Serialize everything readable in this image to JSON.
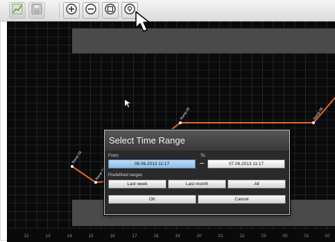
{
  "toolbar": {
    "buttons": [
      {
        "icon": "chart-icon",
        "style": "flat"
      },
      {
        "icon": "save-icon",
        "style": "flat"
      },
      {
        "icon": "zoom-in-icon",
        "style": "round"
      },
      {
        "icon": "zoom-out-icon",
        "style": "round"
      },
      {
        "icon": "zoom-fit-icon",
        "style": "round"
      },
      {
        "icon": "zoom-reset-icon",
        "style": "round"
      }
    ]
  },
  "chart": {
    "background_color": "#0a0a0a",
    "grid_color": "#2b3a44",
    "line_color": "#e86a22",
    "shaded_band_color": "#4a4a4a",
    "x_labels": [
      "12",
      "13",
      "14",
      "15",
      "16",
      "17",
      "18",
      "19",
      "20",
      "21",
      "22",
      "23",
      "00",
      "01",
      "02"
    ],
    "point_labels": [
      "Ramp 03",
      "Ramp 04",
      "Ramp 05",
      "Ramp 06"
    ]
  },
  "dialog": {
    "title": "Select Time Range",
    "from_label": "From:",
    "from_value": "06.06.2013 11:17",
    "to_label": "To:",
    "to_value": "07.06.2013 11:17",
    "predefined_label": "Predefined ranges",
    "range_buttons": [
      "Last week",
      "Last month",
      "All"
    ],
    "ok_label": "OK",
    "cancel_label": "Cancel"
  }
}
